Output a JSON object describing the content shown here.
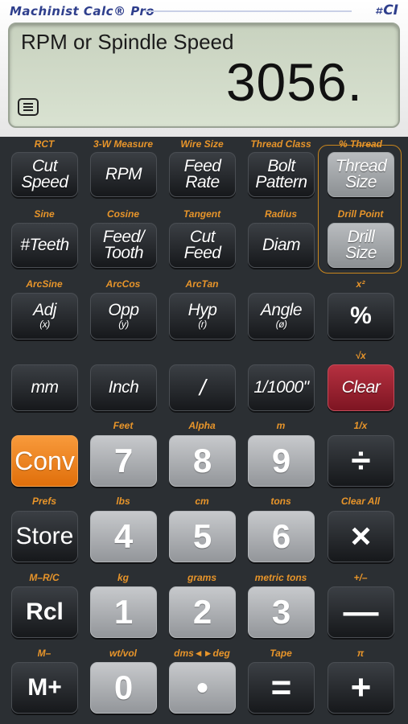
{
  "header": {
    "brand": "Machinist Calc® Pro",
    "logo": "CI"
  },
  "display": {
    "label": "RPM or Spindle Speed",
    "value": "3056."
  },
  "keys": [
    {
      "sub": "RCT",
      "label": "Cut\nSpeed"
    },
    {
      "sub": "3-W Measure",
      "label": "RPM"
    },
    {
      "sub": "Wire Size",
      "label": "Feed\nRate"
    },
    {
      "sub": "Thread Class",
      "label": "Bolt\nPattern"
    },
    {
      "sub": "% Thread",
      "label": "Thread\nSize"
    },
    {
      "sub": "Sine",
      "label": "#Teeth"
    },
    {
      "sub": "Cosine",
      "label": "Feed/\nTooth"
    },
    {
      "sub": "Tangent",
      "label": "Cut\nFeed"
    },
    {
      "sub": "Radius",
      "label": "Diam"
    },
    {
      "sub": "Drill Point",
      "label": "Drill\nSize"
    },
    {
      "sub": "ArcSine",
      "label": "Adj",
      "small": "(x)"
    },
    {
      "sub": "ArcCos",
      "label": "Opp",
      "small": "(y)"
    },
    {
      "sub": "ArcTan",
      "label": "Hyp",
      "small": "(r)"
    },
    {
      "sub": "",
      "label": "Angle",
      "small": "(ø)"
    },
    {
      "sub": "x²",
      "label": "%"
    },
    {
      "sub": "",
      "label": "mm"
    },
    {
      "sub": "",
      "label": "Inch"
    },
    {
      "sub": "",
      "label": "/"
    },
    {
      "sub": "",
      "label": "1/1000\""
    },
    {
      "sub": "√x",
      "label": "Clear"
    },
    {
      "sub": "",
      "label": "Conv"
    },
    {
      "sub": "Feet",
      "label": "7"
    },
    {
      "sub": "Alpha",
      "label": "8"
    },
    {
      "sub": "m",
      "label": "9"
    },
    {
      "sub": "1/x",
      "label": "÷"
    },
    {
      "sub": "Prefs",
      "label": "Store"
    },
    {
      "sub": "lbs",
      "label": "4"
    },
    {
      "sub": "cm",
      "label": "5"
    },
    {
      "sub": "tons",
      "label": "6"
    },
    {
      "sub": "Clear All",
      "label": "×"
    },
    {
      "sub": "M–R/C",
      "label": "Rcl"
    },
    {
      "sub": "kg",
      "label": "1"
    },
    {
      "sub": "grams",
      "label": "2"
    },
    {
      "sub": "metric tons",
      "label": "3"
    },
    {
      "sub": "+/–",
      "label": "—"
    },
    {
      "sub": "M–",
      "label": "M+"
    },
    {
      "sub": "wt/vol",
      "label": "0"
    },
    {
      "sub": "dms◄►deg",
      "label": "•"
    },
    {
      "sub": "Tape",
      "label": "="
    },
    {
      "sub": "π",
      "label": "+"
    }
  ],
  "colors": {
    "accent": "#e8952a",
    "conv": "#f08a24",
    "clear": "#a22233",
    "lcd": "#d2dbc9"
  }
}
